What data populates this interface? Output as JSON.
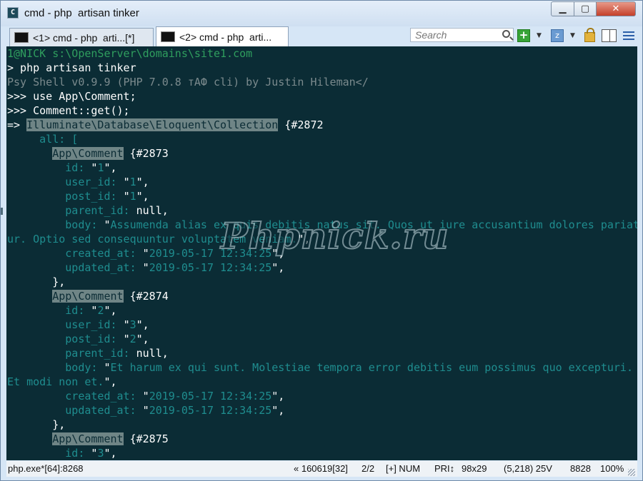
{
  "window": {
    "title": "cmd - php  artisan tinker",
    "controls": {
      "minimize": "▁",
      "maximize": "▢",
      "close": "✕"
    }
  },
  "tabs": [
    {
      "label": "<1> cmd - php  arti...[*]",
      "active": false
    },
    {
      "label": "<2> cmd - php  arti...",
      "active": true
    }
  ],
  "toolbar": {
    "search_placeholder": "Search",
    "new_console": "+",
    "panel_label": "z",
    "dropdown": "▼"
  },
  "console": {
    "lines": [
      {
        "segments": [
          {
            "text": "1@NICK s:\\OpenServer\\domains\\site1.com",
            "style": "green"
          }
        ]
      },
      {
        "segments": [
          {
            "text": "> php artisan tinker",
            "style": "white"
          }
        ]
      },
      {
        "segments": [
          {
            "text": "Psy Shell v0.9.9 (PHP 7.0.8 тАФ cli) by Justin Hileman</",
            "style": "gray"
          }
        ]
      },
      {
        "segments": [
          {
            "text": ">>> use App\\Comment;",
            "style": "white"
          }
        ]
      },
      {
        "segments": [
          {
            "text": ">>> Comment::get();",
            "style": "white"
          }
        ]
      },
      {
        "segments": [
          {
            "text": "=> ",
            "style": "white"
          },
          {
            "text": "Illuminate\\Database\\Eloquent\\Collection",
            "style": "hl"
          },
          {
            "text": " {#2872",
            "style": "white"
          }
        ]
      },
      {
        "segments": [
          {
            "text": "     all: [",
            "style": "teal"
          }
        ]
      },
      {
        "segments": [
          {
            "text": "       ",
            "style": "white"
          },
          {
            "text": "App\\Comment",
            "style": "hl"
          },
          {
            "text": " {#2873",
            "style": "white"
          }
        ]
      },
      {
        "segments": [
          {
            "text": "         id: ",
            "style": "teal"
          },
          {
            "text": "\"",
            "style": "white"
          },
          {
            "text": "1",
            "style": "teal"
          },
          {
            "text": "\",",
            "style": "white"
          }
        ]
      },
      {
        "segments": [
          {
            "text": "         user_id: ",
            "style": "teal"
          },
          {
            "text": "\"",
            "style": "white"
          },
          {
            "text": "1",
            "style": "teal"
          },
          {
            "text": "\",",
            "style": "white"
          }
        ]
      },
      {
        "segments": [
          {
            "text": "         post_id: ",
            "style": "teal"
          },
          {
            "text": "\"",
            "style": "white"
          },
          {
            "text": "1",
            "style": "teal"
          },
          {
            "text": "\",",
            "style": "white"
          }
        ]
      },
      {
        "segments": [
          {
            "text": "         parent_id: ",
            "style": "teal"
          },
          {
            "text": "null",
            "style": "white"
          },
          {
            "text": ",",
            "style": "white"
          }
        ]
      },
      {
        "segments": [
          {
            "text": "         body: ",
            "style": "teal"
          },
          {
            "text": "\"",
            "style": "white"
          },
          {
            "text": "Assumenda alias ex quis debitis natus sit. Quos ut iure accusantium dolores pariat",
            "style": "teal"
          }
        ]
      },
      {
        "segments": [
          {
            "text": "ur. Optio sed consequuntur voluptatem veniam.",
            "style": "teal"
          },
          {
            "text": "\",",
            "style": "white"
          }
        ]
      },
      {
        "segments": [
          {
            "text": "         created_at: ",
            "style": "teal"
          },
          {
            "text": "\"",
            "style": "white"
          },
          {
            "text": "2019-05-17 12:34:25",
            "style": "teal"
          },
          {
            "text": "\",",
            "style": "white"
          }
        ]
      },
      {
        "segments": [
          {
            "text": "         updated_at: ",
            "style": "teal"
          },
          {
            "text": "\"",
            "style": "white"
          },
          {
            "text": "2019-05-17 12:34:25",
            "style": "teal"
          },
          {
            "text": "\",",
            "style": "white"
          }
        ]
      },
      {
        "segments": [
          {
            "text": "       },",
            "style": "white"
          }
        ]
      },
      {
        "segments": [
          {
            "text": "       ",
            "style": "white"
          },
          {
            "text": "App\\Comment",
            "style": "hl"
          },
          {
            "text": " {#2874",
            "style": "white"
          }
        ]
      },
      {
        "segments": [
          {
            "text": "         id: ",
            "style": "teal"
          },
          {
            "text": "\"",
            "style": "white"
          },
          {
            "text": "2",
            "style": "teal"
          },
          {
            "text": "\",",
            "style": "white"
          }
        ]
      },
      {
        "segments": [
          {
            "text": "         user_id: ",
            "style": "teal"
          },
          {
            "text": "\"",
            "style": "white"
          },
          {
            "text": "3",
            "style": "teal"
          },
          {
            "text": "\",",
            "style": "white"
          }
        ]
      },
      {
        "segments": [
          {
            "text": "         post_id: ",
            "style": "teal"
          },
          {
            "text": "\"",
            "style": "white"
          },
          {
            "text": "2",
            "style": "teal"
          },
          {
            "text": "\",",
            "style": "white"
          }
        ]
      },
      {
        "segments": [
          {
            "text": "         parent_id: ",
            "style": "teal"
          },
          {
            "text": "null",
            "style": "white"
          },
          {
            "text": ",",
            "style": "white"
          }
        ]
      },
      {
        "segments": [
          {
            "text": "         body: ",
            "style": "teal"
          },
          {
            "text": "\"",
            "style": "white"
          },
          {
            "text": "Et harum ex qui sunt. Molestiae tempora error debitis eum possimus quo excepturi.",
            "style": "teal"
          }
        ]
      },
      {
        "segments": [
          {
            "text": "Et modi non et.",
            "style": "teal"
          },
          {
            "text": "\",",
            "style": "white"
          }
        ]
      },
      {
        "segments": [
          {
            "text": "         created_at: ",
            "style": "teal"
          },
          {
            "text": "\"",
            "style": "white"
          },
          {
            "text": "2019-05-17 12:34:25",
            "style": "teal"
          },
          {
            "text": "\",",
            "style": "white"
          }
        ]
      },
      {
        "segments": [
          {
            "text": "         updated_at: ",
            "style": "teal"
          },
          {
            "text": "\"",
            "style": "white"
          },
          {
            "text": "2019-05-17 12:34:25",
            "style": "teal"
          },
          {
            "text": "\",",
            "style": "white"
          }
        ]
      },
      {
        "segments": [
          {
            "text": "       },",
            "style": "white"
          }
        ]
      },
      {
        "segments": [
          {
            "text": "       ",
            "style": "white"
          },
          {
            "text": "App\\Comment",
            "style": "hl"
          },
          {
            "text": " {#2875",
            "style": "white"
          }
        ]
      },
      {
        "segments": [
          {
            "text": "         id: ",
            "style": "teal"
          },
          {
            "text": "\"",
            "style": "white"
          },
          {
            "text": "3",
            "style": "teal"
          },
          {
            "text": "\",",
            "style": "white"
          }
        ]
      }
    ],
    "watermark": "Phpnick.ru"
  },
  "statusbar": {
    "process": "php.exe*[64]:8268",
    "build": "« 160619[32]",
    "tab_index": "2/2",
    "mode": "[+] NUM",
    "priority": "PRI↕",
    "size": "98x29",
    "cursor": "(5,218) 25V",
    "pid": "8828",
    "zoom": "100%"
  }
}
